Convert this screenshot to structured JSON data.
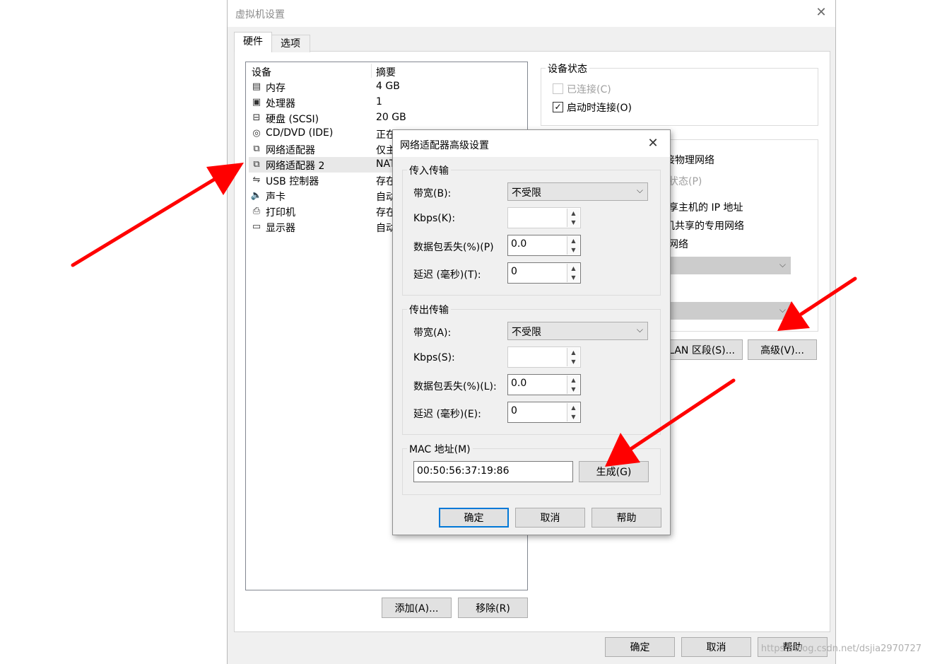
{
  "main_window": {
    "title": "虚拟机设置",
    "tabs": [
      {
        "label": "硬件"
      },
      {
        "label": "选项"
      }
    ],
    "device_list": {
      "headers": [
        "设备",
        "摘要"
      ],
      "rows": [
        {
          "name": "内存",
          "summary": "4 GB",
          "icon": "memory-icon",
          "glyph": "▤"
        },
        {
          "name": "处理器",
          "summary": "1",
          "icon": "cpu-icon",
          "glyph": "▣"
        },
        {
          "name": "硬盘 (SCSI)",
          "summary": "20 GB",
          "icon": "hard-disk-icon",
          "glyph": "⊟"
        },
        {
          "name": "CD/DVD (IDE)",
          "summary": "正在",
          "icon": "cd-dvd-icon",
          "glyph": "◎"
        },
        {
          "name": "网络适配器",
          "summary": "仅主",
          "icon": "network-adapter-icon",
          "glyph": "⧉"
        },
        {
          "name": "网络适配器 2",
          "summary": "NAT",
          "icon": "network-adapter-icon",
          "glyph": "⧉"
        },
        {
          "name": "USB 控制器",
          "summary": "存在",
          "icon": "usb-icon",
          "glyph": "⇋"
        },
        {
          "name": "声卡",
          "summary": "自动",
          "icon": "speaker-icon",
          "glyph": "🔈"
        },
        {
          "name": "打印机",
          "summary": "存在",
          "icon": "printer-icon",
          "glyph": "⎙"
        },
        {
          "name": "显示器",
          "summary": "自动",
          "icon": "monitor-icon",
          "glyph": "▭"
        }
      ],
      "selected_index": 5
    },
    "add_button": "添加(A)...",
    "remove_button": "移除(R)",
    "device_status": {
      "title": "设备状态",
      "connected": "已连接(C)",
      "connect_at_power_on": "启动时连接(O)",
      "connect_at_power_on_checked": true
    },
    "network_connection_partial": {
      "bridged_partial": "接物理网络",
      "replicate_partial": "状态(P)",
      "nat_partial": "享主机的 IP 地址",
      "hostonly_partial": "机共享的专用网络",
      "custom_partial": "网络"
    },
    "lan_segments_button_partial": "LAN 区段(S)...",
    "advanced_button": "高级(V)...",
    "ok_button": "确定",
    "cancel_button": "取消",
    "help_button": "帮助"
  },
  "dialog": {
    "title": "网络适配器高级设置",
    "incoming": {
      "title": "传入传输",
      "bandwidth_label": "带宽(B):",
      "bandwidth_value": "不受限",
      "kbps_label": "Kbps(K):",
      "kbps_value": "",
      "packet_loss_label": "数据包丢失(%)(P)",
      "packet_loss_value": "0.0",
      "latency_label": "延迟 (毫秒)(T):",
      "latency_value": "0"
    },
    "outgoing": {
      "title": "传出传输",
      "bandwidth_label": "带宽(A):",
      "bandwidth_value": "不受限",
      "kbps_label": "Kbps(S):",
      "kbps_value": "",
      "packet_loss_label": "数据包丢失(%)(L):",
      "packet_loss_value": "0.0",
      "latency_label": "延迟 (毫秒)(E):",
      "latency_value": "0"
    },
    "mac": {
      "title": "MAC 地址(M)",
      "value": "00:50:56:37:19:86",
      "generate_button": "生成(G)"
    },
    "ok_button": "确定",
    "cancel_button": "取消",
    "help_button": "帮助"
  },
  "watermark": "https://blog.csdn.net/dsjia2970727",
  "colors": {
    "annotation_arrow": "#ff0000",
    "focus_border": "#0078d7",
    "window_background": "#f0f0f0"
  }
}
